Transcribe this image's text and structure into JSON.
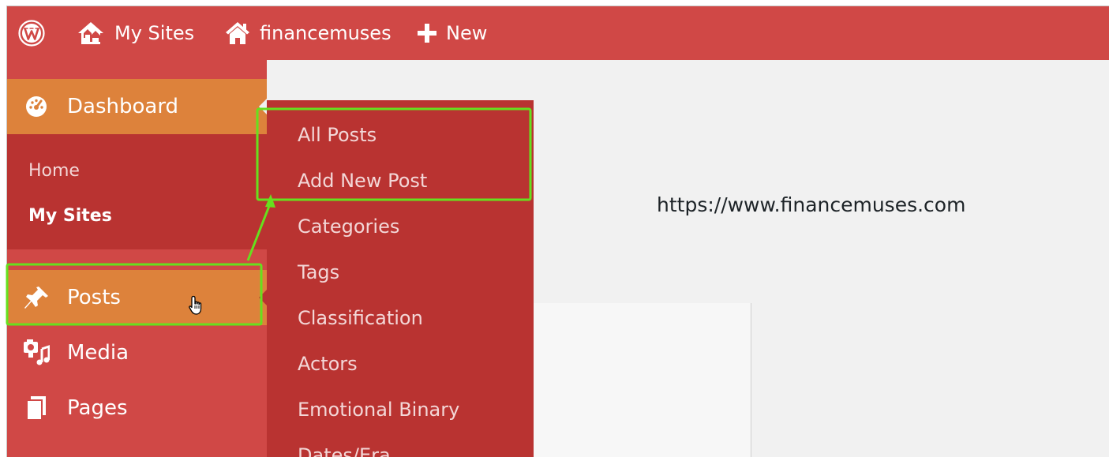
{
  "admin_bar": {
    "my_sites": "My Sites",
    "site_name": "financemuses",
    "new": "New"
  },
  "sidebar": {
    "dashboard": "Dashboard",
    "dashboard_sub": {
      "home": "Home",
      "my_sites": "My Sites"
    },
    "posts": "Posts",
    "media": "Media",
    "pages": "Pages"
  },
  "posts_flyout": [
    "All Posts",
    "Add New Post",
    "Categories",
    "Tags",
    "Classification",
    "Actors",
    "Emotional Binary",
    "Dates/Era"
  ],
  "content": {
    "site_url": "https://www.financemuses.com"
  },
  "colors": {
    "admin_bar": "#d04846",
    "sidebar": "#d04846",
    "submenu": "#b93331",
    "active_menu": "#dd823b",
    "highlight": "#66e01e",
    "content_bg": "#f1f1f1"
  },
  "icons": {
    "wordpress": "wordpress-logo-icon",
    "my_sites": "houses-icon",
    "site": "home-icon",
    "new": "plus-icon",
    "dashboard": "dashboard-gauge-icon",
    "posts": "pushpin-icon",
    "media": "media-camera-music-icon",
    "pages": "pages-icon",
    "cursor": "hand-pointer-icon"
  }
}
